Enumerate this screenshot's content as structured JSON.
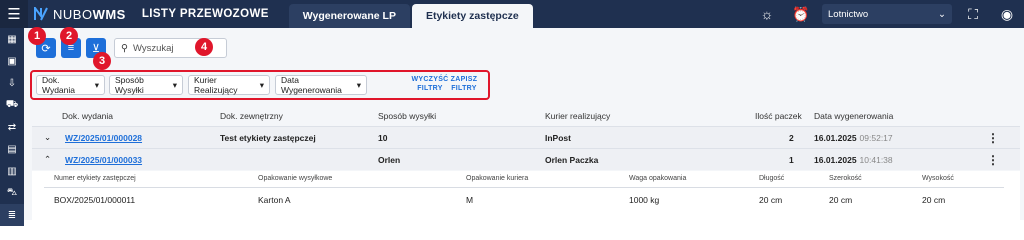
{
  "app": {
    "logo_prefix": "NUBO",
    "logo_suffix": "WMS",
    "title": "LISTY PRZEWOZOWE",
    "tabs": [
      {
        "label": "Wygenerowane LP",
        "active": false
      },
      {
        "label": "Etykiety zastępcze",
        "active": true
      }
    ],
    "company": "Lotnictwo"
  },
  "toolbar": {
    "search_placeholder": "Wyszukaj",
    "badges": [
      "1",
      "2",
      "3",
      "4"
    ],
    "accent_color": "#1e6fd9",
    "highlight_color": "#e0162b"
  },
  "filters": {
    "selects": [
      "Dok. Wydania",
      "Sposób Wysyłki",
      "Kurier Realizujący",
      "Data Wygenerowania"
    ],
    "clear_label": "WYCZYŚĆ FILTRY",
    "save_label": "ZAPISZ FILTRY"
  },
  "table": {
    "headers": [
      "Dok. wydania",
      "Dok. zewnętrzny",
      "Sposób wysyłki",
      "Kurier realizujący",
      "Ilość paczek",
      "Data wygenerowania"
    ],
    "rows": [
      {
        "doc": "WZ/2025/01/000028",
        "external": "Test etykiety zastępczej",
        "shipping": "10",
        "courier": "InPost",
        "packages": "2",
        "date": "16.01.2025",
        "time": "09:52:17",
        "expanded": false
      },
      {
        "doc": "WZ/2025/01/000033",
        "external": "",
        "shipping": "Orlen",
        "courier": "Orlen Paczka",
        "packages": "1",
        "date": "16.01.2025",
        "time": "10:41:38",
        "expanded": true
      }
    ]
  },
  "detail": {
    "headers": [
      "Numer etykiety zastępczej",
      "Opakowanie wysyłkowe",
      "Opakowanie kuriera",
      "Waga opakowania",
      "Długość",
      "Szerokość",
      "Wysokość"
    ],
    "values": [
      "BOX/2025/01/000011",
      "Karton A",
      "M",
      "1000 kg",
      "20 cm",
      "20 cm",
      "20 cm"
    ]
  }
}
